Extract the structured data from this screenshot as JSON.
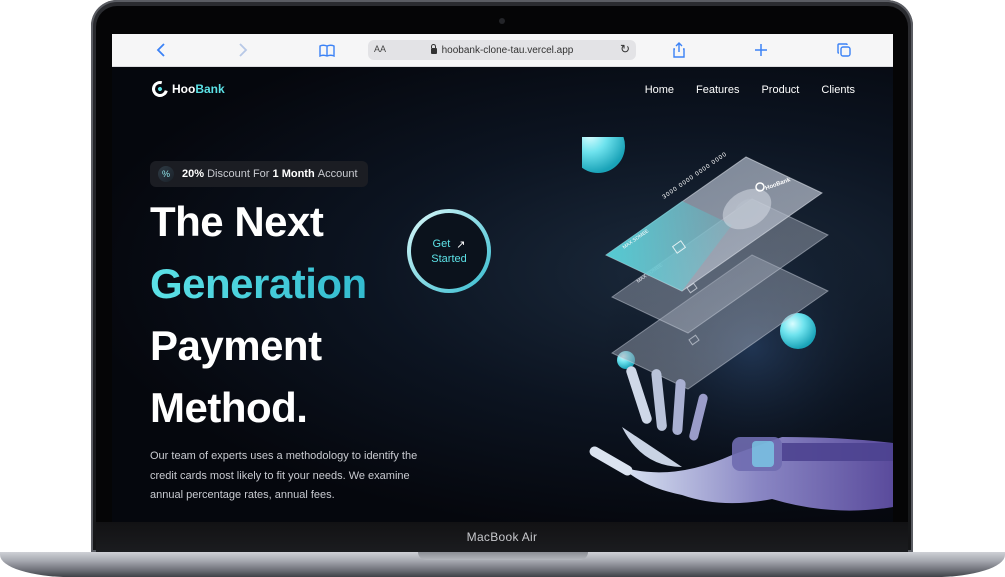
{
  "device": {
    "label": "MacBook Air"
  },
  "browser": {
    "text_size_label": "AA",
    "url": "hoobank-clone-tau.vercel.app"
  },
  "brand": {
    "name_first": "Hoo",
    "name_second": "Bank",
    "accent_color": "#5ce1e6"
  },
  "nav": {
    "items": [
      "Home",
      "Features",
      "Product",
      "Clients"
    ]
  },
  "discount": {
    "icon_glyph": "%",
    "percent": "20%",
    "text_middle": "Discount For",
    "duration": "1 Month",
    "text_end": "Account"
  },
  "hero": {
    "line1": "The Next",
    "line2": "Generation",
    "line3": "Payment",
    "line4": "Method.",
    "paragraph": "Our team of experts uses a methodology to identify the credit cards most likely to fit your needs. We examine annual percentage rates, annual fees."
  },
  "cta": {
    "line1": "Get",
    "line2": "Started",
    "arrow": "↗"
  },
  "cards": {
    "number": "3000 0000 0000 0000",
    "holder": "MAX SOMBE",
    "brand_label": "HooBank"
  },
  "icons": [
    "chevron-left-icon",
    "chevron-right-icon",
    "book-icon",
    "lock-icon",
    "reload-icon",
    "share-icon",
    "plus-icon",
    "tabs-icon"
  ]
}
